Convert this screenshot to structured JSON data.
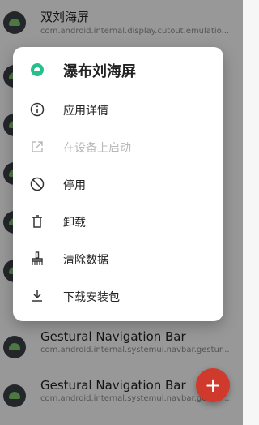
{
  "background_list": [
    {
      "title": "双刘海屏",
      "package": "com.android.internal.display.cutout.emulatio..."
    },
    {
      "title": "",
      "package": ""
    },
    {
      "title": "",
      "package": ""
    },
    {
      "title": "",
      "package": ""
    },
    {
      "title": "",
      "package": ""
    },
    {
      "title": "",
      "package": ""
    },
    {
      "title": "",
      "package": ""
    },
    {
      "title": "Gestural Navigation Bar",
      "package": "com.android.internal.systemui.navbar.gestur..."
    },
    {
      "title": "Gestural Navigation Bar",
      "package": "com.android.internal.systemui.navbar.gestur..."
    }
  ],
  "menu": {
    "title": "瀑布刘海屏",
    "items": [
      {
        "label": "应用详情",
        "icon": "info-icon"
      },
      {
        "label": "在设备上启动",
        "icon": "launch-icon"
      },
      {
        "label": "停用",
        "icon": "block-icon"
      },
      {
        "label": "卸载",
        "icon": "trash-icon"
      },
      {
        "label": "清除数据",
        "icon": "broom-icon"
      },
      {
        "label": "下载安装包",
        "icon": "download-icon"
      }
    ]
  },
  "fab": {
    "label": "+"
  },
  "colors": {
    "accent": "#27c08c",
    "fab": "#d03a2c",
    "scrim": "rgba(0,0,0,0.38)"
  }
}
